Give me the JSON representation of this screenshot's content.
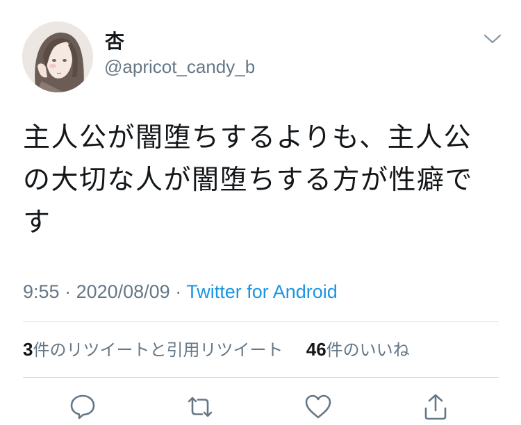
{
  "author": {
    "display_name": "杏",
    "handle": "@apricot_candy_b"
  },
  "tweet": {
    "text": "主人公が闇堕ちするよりも、主人公の大切な人が闇堕ちする方が性癖です"
  },
  "meta": {
    "time": "9:55",
    "separator": " · ",
    "date": "2020/08/09",
    "source": "Twitter for Android"
  },
  "stats": {
    "retweet_count": "3",
    "retweet_label": "件のリツイートと引用リツイート",
    "like_count": "46",
    "like_label": "件のいいね"
  },
  "actions": {
    "reply": "reply-icon",
    "retweet": "retweet-icon",
    "like": "heart-icon",
    "share": "share-icon"
  },
  "colors": {
    "text": "#14171a",
    "secondary": "#657786",
    "link": "#1b95e0",
    "divider": "#d8dde1"
  }
}
